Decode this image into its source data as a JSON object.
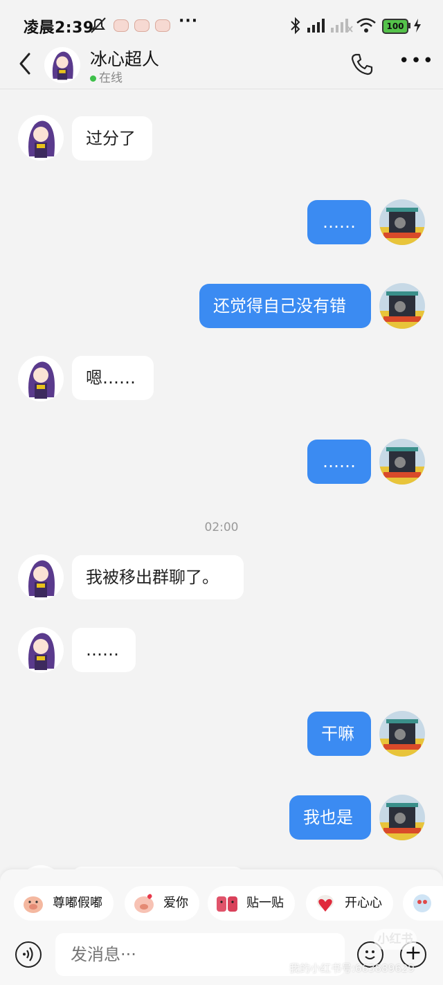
{
  "status_bar": {
    "time": "凌晨2:39",
    "more": "···",
    "battery": "100"
  },
  "header": {
    "contact_name": "冰心超人",
    "status": "在线"
  },
  "messages": [
    {
      "side": "in",
      "text": "过分了"
    },
    {
      "side": "out",
      "text": "……"
    },
    {
      "side": "out",
      "text": "还觉得自己没有错"
    },
    {
      "side": "in",
      "text": "嗯……"
    },
    {
      "side": "out",
      "text": "……"
    },
    {
      "side": "in",
      "text": "我被移出群聊了。"
    },
    {
      "side": "in",
      "text": "……"
    },
    {
      "side": "out",
      "text": "干嘛"
    },
    {
      "side": "out",
      "text": "我也是"
    }
  ],
  "timestamp": "02:00",
  "quick_replies": [
    {
      "label": "尊嘟假嘟"
    },
    {
      "label": "爱你"
    },
    {
      "label": "贴一贴"
    },
    {
      "label": "开心心"
    }
  ],
  "input": {
    "placeholder": "发消息···"
  },
  "watermark": {
    "logo": "小红书",
    "text": "我的小红书号:663889629"
  },
  "colors": {
    "outgoing_bubble": "#3b8bf2",
    "incoming_bubble": "#ffffff",
    "background": "#f3f3f3",
    "online_dot": "#3ec04a"
  }
}
